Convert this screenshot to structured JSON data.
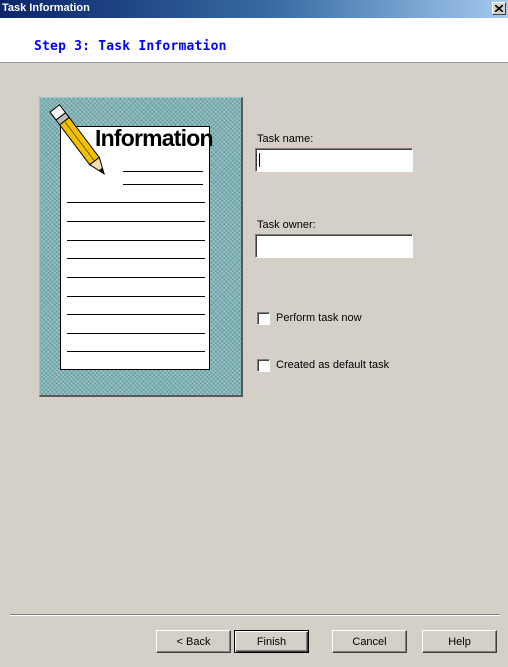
{
  "window": {
    "title": "Task Information",
    "close_icon": "close-icon"
  },
  "header": {
    "step_title": "Step 3: Task Information"
  },
  "illustration": {
    "heading": "Information",
    "icon": "pencil-icon",
    "background_color": "#7fb2b4"
  },
  "form": {
    "task_name_label": "Task name:",
    "task_name_value": "",
    "task_owner_label": "Task owner:",
    "task_owner_value": "",
    "perform_now_label": "Perform task now",
    "perform_now_checked": false,
    "default_task_label": "Created as default task",
    "default_task_checked": false
  },
  "buttons": {
    "back": "< Back",
    "finish": "Finish",
    "cancel": "Cancel",
    "help": "Help"
  },
  "colors": {
    "titlebar_start": "#0a246a",
    "step_title": "#0000ff",
    "dialog_bg": "#d4d0c8"
  }
}
